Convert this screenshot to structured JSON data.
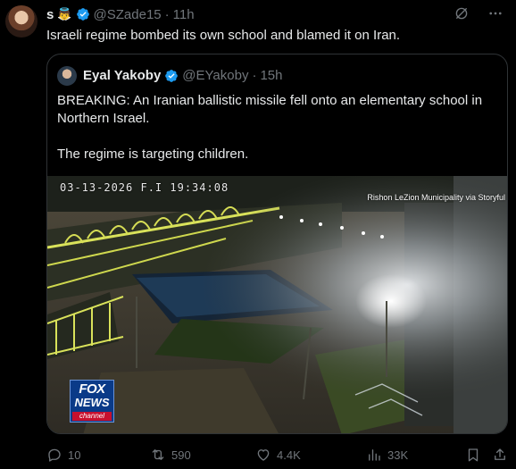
{
  "post": {
    "author": {
      "display_name": "s",
      "emoji": "👼",
      "handle": "@SZade15",
      "separator": "·",
      "time": "11h"
    },
    "text": "Israeli regime bombed its own school and blamed it on Iran."
  },
  "quote": {
    "author": {
      "display_name": "Eyal Yakoby",
      "handle": "@EYakoby",
      "separator": "·",
      "time": "15h"
    },
    "text_line1": "BREAKING: An Iranian ballistic missile fell onto an elementary school in Northern Israel.",
    "text_line2": "The regime is targeting children.",
    "media": {
      "timestamp": "03-13-2026 F.I 19:34:08",
      "credit": "Rishon LeZion Municipality via Storyful",
      "logo": {
        "line1": "FOX",
        "line2": "NEWS",
        "line3": "channel"
      }
    }
  },
  "actions": {
    "replies": "10",
    "reposts": "590",
    "likes": "4.4K",
    "views": "33K"
  },
  "icons": {
    "verified": "verified-badge-icon",
    "grok": "grok-icon",
    "more": "more-icon",
    "reply": "reply-icon",
    "repost": "repost-icon",
    "like": "like-icon",
    "views": "views-icon",
    "bookmark": "bookmark-icon",
    "share": "share-icon"
  },
  "colors": {
    "background": "#000000",
    "text": "#e7e9ea",
    "muted": "#71767b",
    "verified": "#1d9bf0",
    "border": "#2f3336"
  }
}
